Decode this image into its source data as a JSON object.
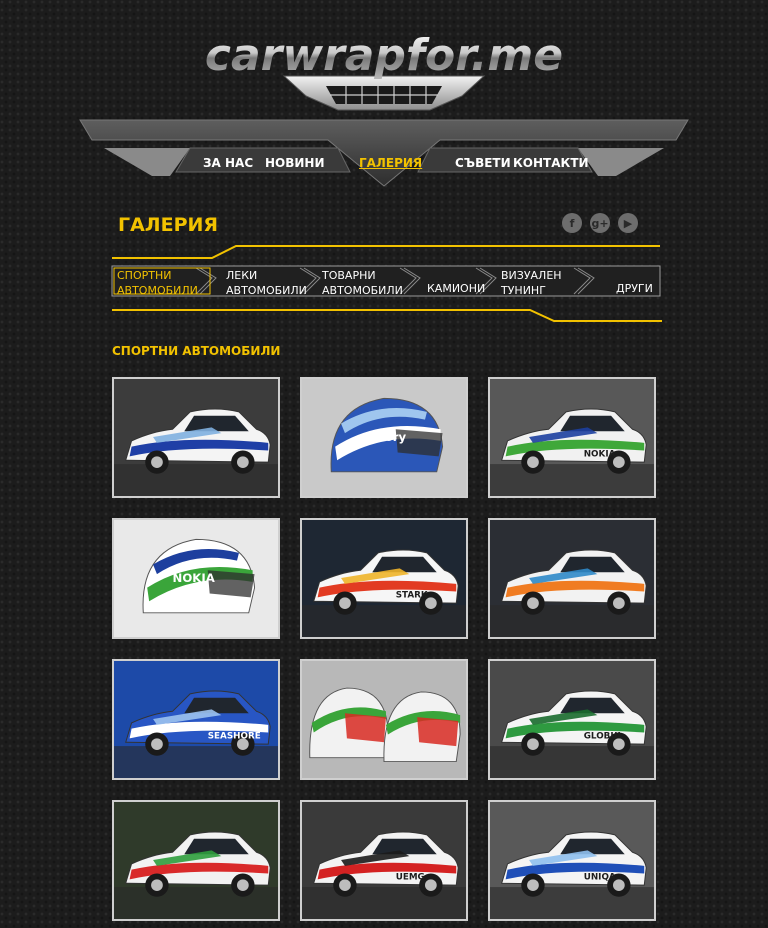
{
  "site": {
    "logo_text": "carwrapfor.me"
  },
  "nav": [
    {
      "label": "ЗА НАС"
    },
    {
      "label": "НОВИНИ"
    },
    {
      "label": "ГАЛЕРИЯ"
    },
    {
      "label": "СЪВЕТИ"
    },
    {
      "label": "КОНТАКТИ"
    }
  ],
  "social": [
    {
      "icon": "facebook-icon",
      "glyph": "f"
    },
    {
      "icon": "google-plus-icon",
      "glyph": "g+"
    },
    {
      "icon": "youtube-icon",
      "glyph": "▶"
    }
  ],
  "page": {
    "title": "ГАЛЕРИЯ"
  },
  "categories": [
    {
      "line1": "СПОРТНИ",
      "line2": "АВТОМОБИЛИ"
    },
    {
      "line1": "ЛЕКИ",
      "line2": "АВТОМОБИЛИ"
    },
    {
      "line1": "ТОВАРНИ",
      "line2": "АВТОМОБИЛИ"
    },
    {
      "line1": "",
      "line2": "КАМИОНИ"
    },
    {
      "line1": "ВИЗУАЛЕН",
      "line2": "ТУНИНГ"
    },
    {
      "line1": "",
      "line2": "ДРУГИ"
    }
  ],
  "gallery": {
    "section_title": "СПОРТНИ АВТОМОБИЛИ",
    "items": [
      {
        "kind": "car",
        "bg": "#3c3c3c",
        "body": "#f4f4f4",
        "stripe": "#1f3fa6",
        "accent": "#7fb0e0",
        "text": ""
      },
      {
        "kind": "helmet",
        "bg": "#c9c9c9",
        "body": "#2b57b8",
        "stripe": "#ffffff",
        "accent": "#9fc6ee",
        "text": "victory"
      },
      {
        "kind": "car",
        "bg": "#585858",
        "body": "#f1f1f1",
        "stripe": "#3fa83a",
        "accent": "#1c3fa0",
        "text": "NOKIA"
      },
      {
        "kind": "helmet",
        "bg": "#e9e9e9",
        "body": "#ffffff",
        "stripe": "#3aa53a",
        "accent": "#1d3f9e",
        "text": "NOKIA"
      },
      {
        "kind": "car",
        "bg": "#1e2733",
        "body": "#f6f6f6",
        "stripe": "#e23b22",
        "accent": "#f0b52a",
        "text": "STARK"
      },
      {
        "kind": "car",
        "bg": "#2b2e34",
        "body": "#f2f2f2",
        "stripe": "#f07c22",
        "accent": "#2f89c9",
        "text": ""
      },
      {
        "kind": "car",
        "bg": "#1d4aa8",
        "body": "#2856c4",
        "stripe": "#ffffff",
        "accent": "#9cc3f0",
        "text": "SEASHORE"
      },
      {
        "kind": "helmets",
        "bg": "#b8b8b8",
        "body": "#f2f2f2",
        "stripe": "#3aa53a",
        "accent": "#d82a22",
        "text": ""
      },
      {
        "kind": "car",
        "bg": "#4a4a4a",
        "body": "#f4f4f4",
        "stripe": "#2e9a40",
        "accent": "#1a6b2e",
        "text": "GLOBUL"
      },
      {
        "kind": "car",
        "bg": "#2f3a2a",
        "body": "#f2f2f2",
        "stripe": "#d92a2a",
        "accent": "#2f9e3d",
        "text": ""
      },
      {
        "kind": "car",
        "bg": "#3a3a3a",
        "body": "#f3f3f3",
        "stripe": "#d42222",
        "accent": "#1b1b1b",
        "text": "UEMG"
      },
      {
        "kind": "car",
        "bg": "#595959",
        "body": "#f4f4f4",
        "stripe": "#1f4fb8",
        "accent": "#8fc0ee",
        "text": "UNIQA"
      }
    ]
  }
}
